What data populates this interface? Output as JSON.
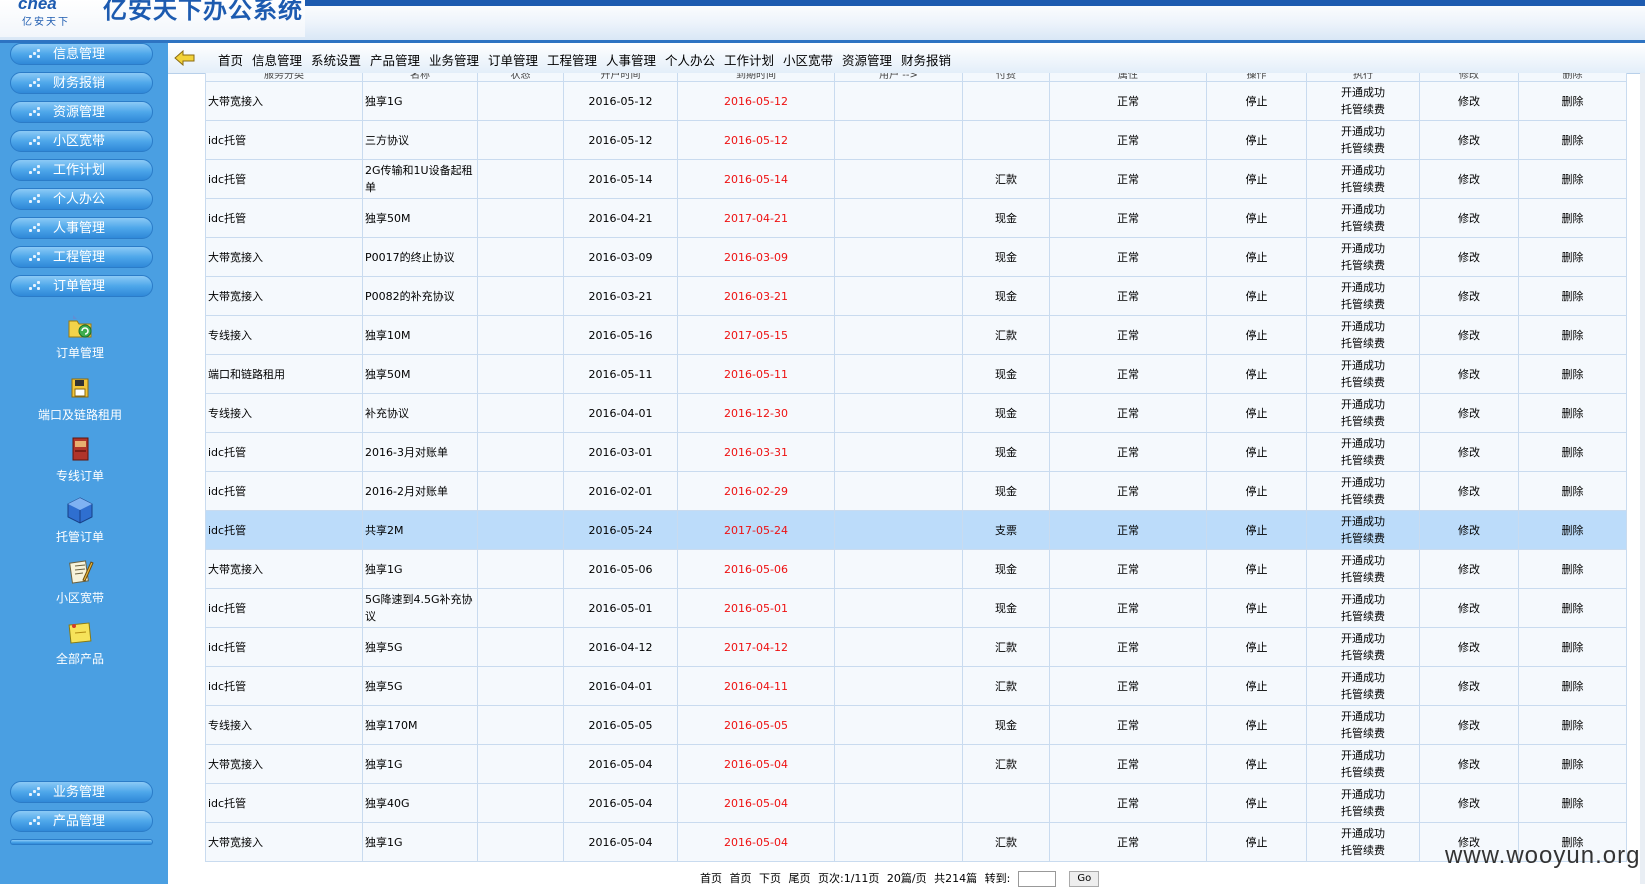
{
  "header": {
    "logo_en": "cnea",
    "logo_cn": "亿安天下",
    "title": "亿安天下办公系统"
  },
  "sidebar": {
    "top_items": [
      "信息管理",
      "财务报销",
      "资源管理",
      "小区宽带",
      "工作计划",
      "个人办公",
      "人事管理",
      "工程管理",
      "订单管理"
    ],
    "sub_items": [
      "订单管理",
      "端口及链路租用",
      "专线订单",
      "托管订单",
      "小区宽带",
      "全部产品"
    ],
    "bottom_items": [
      "业务管理",
      "产品管理"
    ]
  },
  "topnav": [
    "首页",
    "信息管理",
    "系统设置",
    "产品管理",
    "业务管理",
    "订单管理",
    "工程管理",
    "人事管理",
    "个人办公",
    "工作计划",
    "小区宽带",
    "资源管理",
    "财务报销"
  ],
  "table": {
    "headers": [
      "服务分类",
      "名称",
      "状态",
      "开户时间",
      "到期时间",
      "用户 -->",
      "付费",
      "属性",
      "操作",
      "执行",
      "修改",
      "删除"
    ],
    "rows": [
      [
        "大带宽接入",
        "独享1G",
        "",
        "2016-05-12",
        "2016-05-12",
        "",
        "",
        "正常",
        "停止",
        "开通成功",
        "托管续费",
        "修改",
        "删除"
      ],
      [
        "idc托管",
        "三方协议",
        "",
        "2016-05-12",
        "2016-05-12",
        "",
        "",
        "正常",
        "停止",
        "开通成功",
        "托管续费",
        "修改",
        "删除"
      ],
      [
        "idc托管",
        "2G传输和1U设备起租单",
        "",
        "2016-05-14",
        "2016-05-14",
        "",
        "汇款",
        "正常",
        "停止",
        "开通成功",
        "托管续费",
        "修改",
        "删除"
      ],
      [
        "idc托管",
        "独享50M",
        "",
        "2016-04-21",
        "2017-04-21",
        "",
        "现金",
        "正常",
        "停止",
        "开通成功",
        "托管续费",
        "修改",
        "删除"
      ],
      [
        "大带宽接入",
        "P0017的终止协议",
        "",
        "2016-03-09",
        "2016-03-09",
        "",
        "现金",
        "正常",
        "停止",
        "开通成功",
        "托管续费",
        "修改",
        "删除"
      ],
      [
        "大带宽接入",
        "P0082的补充协议",
        "",
        "2016-03-21",
        "2016-03-21",
        "",
        "现金",
        "正常",
        "停止",
        "开通成功",
        "托管续费",
        "修改",
        "删除"
      ],
      [
        "专线接入",
        "独享10M",
        "",
        "2016-05-16",
        "2017-05-15",
        "",
        "汇款",
        "正常",
        "停止",
        "开通成功",
        "托管续费",
        "修改",
        "删除"
      ],
      [
        "端口和链路租用",
        "独享50M",
        "",
        "2016-05-11",
        "2016-05-11",
        "",
        "现金",
        "正常",
        "停止",
        "开通成功",
        "托管续费",
        "修改",
        "删除"
      ],
      [
        "专线接入",
        "补充协议",
        "",
        "2016-04-01",
        "2016-12-30",
        "",
        "现金",
        "正常",
        "停止",
        "开通成功",
        "托管续费",
        "修改",
        "删除"
      ],
      [
        "idc托管",
        "2016-3月对账单",
        "",
        "2016-03-01",
        "2016-03-31",
        "",
        "现金",
        "正常",
        "停止",
        "开通成功",
        "托管续费",
        "修改",
        "删除"
      ],
      [
        "idc托管",
        "2016-2月对账单",
        "",
        "2016-02-01",
        "2016-02-29",
        "",
        "现金",
        "正常",
        "停止",
        "开通成功",
        "托管续费",
        "修改",
        "删除"
      ],
      [
        "idc托管",
        "共享2M",
        "",
        "2016-05-24",
        "2017-05-24",
        "",
        "支票",
        "正常",
        "停止",
        "开通成功",
        "托管续费",
        "修改",
        "删除"
      ],
      [
        "大带宽接入",
        "独享1G",
        "",
        "2016-05-06",
        "2016-05-06",
        "",
        "现金",
        "正常",
        "停止",
        "开通成功",
        "托管续费",
        "修改",
        "删除"
      ],
      [
        "idc托管",
        "5G降速到4.5G补充协议",
        "",
        "2016-05-01",
        "2016-05-01",
        "",
        "现金",
        "正常",
        "停止",
        "开通成功",
        "托管续费",
        "修改",
        "删除"
      ],
      [
        "idc托管",
        "独享5G",
        "",
        "2016-04-12",
        "2017-04-12",
        "",
        "汇款",
        "正常",
        "停止",
        "开通成功",
        "托管续费",
        "修改",
        "删除"
      ],
      [
        "idc托管",
        "独享5G",
        "",
        "2016-04-01",
        "2016-04-11",
        "",
        "汇款",
        "正常",
        "停止",
        "开通成功",
        "托管续费",
        "修改",
        "删除"
      ],
      [
        "专线接入",
        "独享170M",
        "",
        "2016-05-05",
        "2016-05-05",
        "",
        "现金",
        "正常",
        "停止",
        "开通成功",
        "托管续费",
        "修改",
        "删除"
      ],
      [
        "大带宽接入",
        "独享1G",
        "",
        "2016-05-04",
        "2016-05-04",
        "",
        "汇款",
        "正常",
        "停止",
        "开通成功",
        "托管续费",
        "修改",
        "删除"
      ],
      [
        "idc托管",
        "独享40G",
        "",
        "2016-05-04",
        "2016-05-04",
        "",
        "",
        "正常",
        "停止",
        "开通成功",
        "托管续费",
        "修改",
        "删除"
      ],
      [
        "大带宽接入",
        "独享1G",
        "",
        "2016-05-04",
        "2016-05-04",
        "",
        "汇款",
        "正常",
        "停止",
        "开通成功",
        "托管续费",
        "修改",
        "删除"
      ]
    ],
    "highlighted_row": 11
  },
  "pager": {
    "first": "首页",
    "prev": "首页",
    "next": "下页",
    "last": "尾页",
    "page_info": "页次:1/11页",
    "per_page": "20篇/页",
    "total": "共214篇",
    "goto_label": "转到:",
    "go_button": "Go"
  },
  "watermark": "www.wooyun.org",
  "colors": {
    "sidebar": "#4a9fe2",
    "header_accent": "#1d5bb0",
    "expiry_text": "#ee1111",
    "highlight_row": "#bcdcfa"
  }
}
